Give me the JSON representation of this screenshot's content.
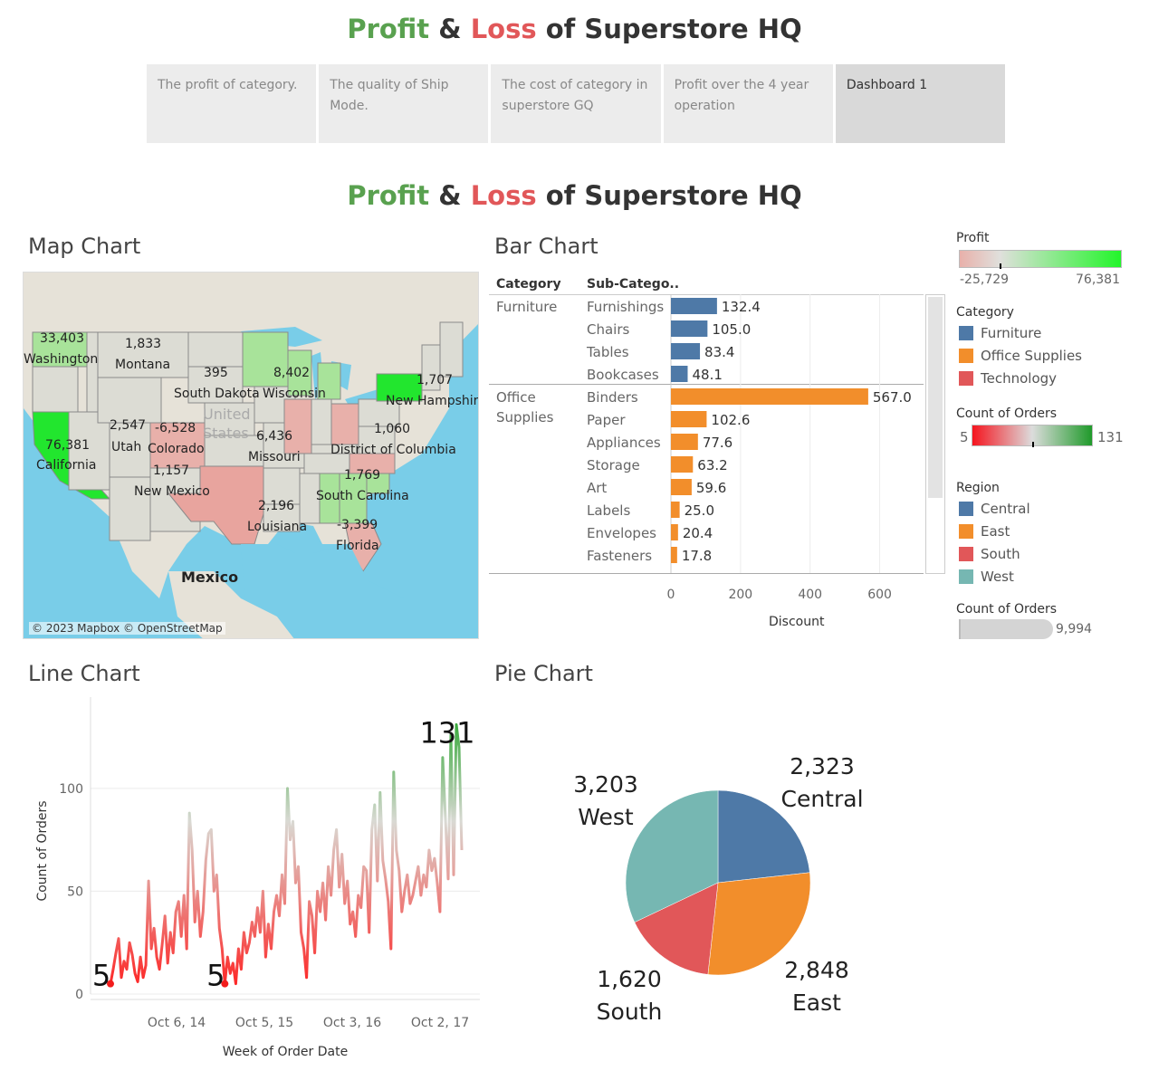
{
  "header": {
    "title_profit": "Profit",
    "title_amp": "&",
    "title_loss": "Loss",
    "title_rest": "of Superstore HQ"
  },
  "tabs": [
    {
      "label": "The profit of category.",
      "active": false
    },
    {
      "label": "The quality of Ship Mode.",
      "active": false
    },
    {
      "label": "The cost of category in superstore GQ",
      "active": false
    },
    {
      "label": "Profit over the 4 year operation",
      "active": false
    },
    {
      "label": "Dashboard 1",
      "active": true
    }
  ],
  "dashboard": {
    "title_profit": "Profit",
    "title_amp": "&",
    "title_loss": "Loss",
    "title_rest": "of Superstore HQ"
  },
  "map": {
    "title": "Map Chart",
    "attribution": "© 2023 Mapbox © OpenStreetMap",
    "labels": {
      "washington_val": "33,403",
      "washington": "Washington",
      "montana_val": "1,833",
      "montana": "Montana",
      "south_dakota_val": "395",
      "south_dakota": "South Dakota",
      "wisconsin_val": "8,402",
      "wisconsin": "Wisconsin",
      "nh_val": "1,707",
      "nh": "New Hampshir",
      "united": "United",
      "states": "States",
      "utah_val": "2,547",
      "utah": "Utah",
      "colorado_val": "-6,528",
      "colorado": "Colorado",
      "missouri_val": "6,436",
      "missouri": "Missouri",
      "dc_val": "1,060",
      "dc": "District of Columbia",
      "california_val": "76,381",
      "california": "California",
      "nm_val": "1,157",
      "nm": "New Mexico",
      "sc_val": "1,769",
      "sc": "South Carolina",
      "louisiana_val": "2,196",
      "louisiana": "Louisiana",
      "florida_val": "-3,399",
      "florida": "Florida",
      "mexico": "Mexico"
    },
    "colors": {
      "water": "#79cde8",
      "land": "#e6e2d8",
      "state_neutral": "#dcdcd4",
      "state_pos": "#a8e39a",
      "state_neg": "#e8b0aa",
      "state_max": "#22e62e"
    }
  },
  "bar": {
    "title": "Bar Chart",
    "col_category": "Category",
    "col_subcategory": "Sub-Catego..",
    "axis_title": "Discount",
    "chart_data": {
      "type": "bar",
      "xlabel": "Discount",
      "xlim": [
        0,
        700
      ],
      "ticks": [
        "0",
        "200",
        "400",
        "600"
      ],
      "groups": [
        {
          "category": "Furniture",
          "color": "#4e79a7",
          "items": [
            {
              "name": "Furnishings",
              "value": 132.4,
              "label": "132.4"
            },
            {
              "name": "Chairs",
              "value": 105.0,
              "label": "105.0"
            },
            {
              "name": "Tables",
              "value": 83.4,
              "label": "83.4"
            },
            {
              "name": "Bookcases",
              "value": 48.1,
              "label": "48.1"
            }
          ]
        },
        {
          "category": "Office Supplies",
          "color": "#f28e2b",
          "items": [
            {
              "name": "Binders",
              "value": 567.0,
              "label": "567.0"
            },
            {
              "name": "Paper",
              "value": 102.6,
              "label": "102.6"
            },
            {
              "name": "Appliances",
              "value": 77.6,
              "label": "77.6"
            },
            {
              "name": "Storage",
              "value": 63.2,
              "label": "63.2"
            },
            {
              "name": "Art",
              "value": 59.6,
              "label": "59.6"
            },
            {
              "name": "Labels",
              "value": 25.0,
              "label": "25.0"
            },
            {
              "name": "Envelopes",
              "value": 20.4,
              "label": "20.4"
            },
            {
              "name": "Fasteners",
              "value": 17.8,
              "label": "17.8"
            }
          ]
        }
      ]
    }
  },
  "legends": {
    "profit": {
      "title": "Profit",
      "min": "-25,729",
      "max": "76,381"
    },
    "category": {
      "title": "Category",
      "items": [
        {
          "label": "Furniture",
          "color": "#4e79a7"
        },
        {
          "label": "Office Supplies",
          "color": "#f28e2b"
        },
        {
          "label": "Technology",
          "color": "#e15759"
        }
      ]
    },
    "orders": {
      "title": "Count of Orders",
      "min": "5",
      "max": "131"
    },
    "region": {
      "title": "Region",
      "items": [
        {
          "label": "Central",
          "color": "#4e79a7"
        },
        {
          "label": "East",
          "color": "#f28e2b"
        },
        {
          "label": "South",
          "color": "#e15759"
        },
        {
          "label": "West",
          "color": "#76b7b2"
        }
      ]
    },
    "orders_size": {
      "title": "Count of Orders",
      "value": "9,994"
    }
  },
  "line": {
    "title": "Line Chart",
    "chart_data": {
      "type": "line",
      "xlabel": "Week of Order Date",
      "ylabel": "Count of Orders",
      "ylim": [
        0,
        140
      ],
      "yticks": [
        "0",
        "50",
        "100"
      ],
      "xticks": [
        "Oct 6, 14",
        "Oct 5, 15",
        "Oct 3, 16",
        "Oct 2, 17"
      ],
      "min_label": "5",
      "max_label": "131",
      "values": [
        5,
        12,
        20,
        27,
        8,
        16,
        12,
        25,
        19,
        10,
        6,
        18,
        8,
        14,
        55,
        22,
        32,
        18,
        12,
        24,
        38,
        15,
        30,
        20,
        40,
        45,
        28,
        48,
        22,
        88,
        70,
        35,
        50,
        28,
        40,
        65,
        78,
        80,
        50,
        58,
        32,
        22,
        5,
        18,
        10,
        15,
        5,
        22,
        12,
        30,
        20,
        25,
        35,
        28,
        42,
        30,
        50,
        18,
        34,
        22,
        40,
        48,
        38,
        58,
        44,
        100,
        75,
        84,
        54,
        62,
        30,
        22,
        8,
        45,
        38,
        20,
        50,
        40,
        54,
        36,
        62,
        48,
        70,
        80,
        52,
        68,
        44,
        55,
        34,
        40,
        28,
        48,
        42,
        62,
        60,
        30,
        80,
        92,
        55,
        98,
        65,
        56,
        45,
        22,
        108,
        70,
        60,
        40,
        50,
        58,
        44,
        48,
        55,
        62,
        48,
        58,
        52,
        70,
        60,
        66,
        54,
        40,
        115,
        85,
        56,
        126,
        58,
        131,
        120,
        70
      ]
    }
  },
  "pie": {
    "title": "Pie Chart",
    "chart_data": {
      "type": "pie",
      "slices": [
        {
          "name": "Central",
          "value": 2323,
          "label": "2,323",
          "color": "#4e79a7"
        },
        {
          "name": "East",
          "value": 2848,
          "label": "2,848",
          "color": "#f28e2b"
        },
        {
          "name": "South",
          "value": 1620,
          "label": "1,620",
          "color": "#e15759"
        },
        {
          "name": "West",
          "value": 3203,
          "label": "3,203",
          "color": "#76b7b2"
        }
      ]
    }
  }
}
